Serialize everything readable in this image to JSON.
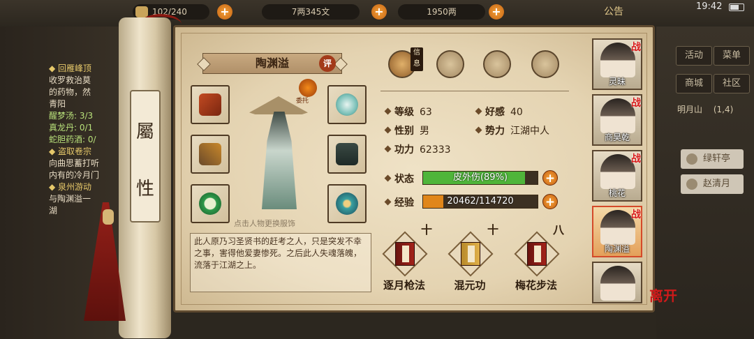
{
  "topbar": {
    "bag_label": "货物",
    "bag_count": "102/240",
    "copper": "7两345文",
    "silver": "1950两",
    "notice": "公告",
    "clock": "19:42"
  },
  "quest_log": {
    "q1_title": "◆ 回雁峰顶",
    "q1_lines": [
      "收罗救治莫",
      "的药物，然",
      "青阳"
    ],
    "q1_items": [
      "醒梦汤: 3/3",
      "真龙丹: 0/1",
      "蛇胆药酒: 0/"
    ],
    "q2_title": "◆ 盗取卷宗",
    "q2_lines": [
      "向曲思蓄打听",
      "内有的冷月门"
    ],
    "q3_title": "◆ 泉州游动",
    "q3_lines": [
      "与陶渊溢一",
      "湖"
    ]
  },
  "scroll": {
    "label_top": "屬",
    "label_bottom": "性"
  },
  "character": {
    "name": "陶渊溢",
    "rate_label": "评",
    "entrust_label": "委托",
    "hint": "点击人物更换服饰",
    "bio": "此人原乃习圣贤书的赶考之人，只是突发不幸之事，害得他爱妻惨死。之后此人失魂落魄，流落于江湖之上。"
  },
  "tabs": {
    "info_tag": "信息"
  },
  "stats": {
    "level_label": "等级",
    "level": "63",
    "favor_label": "好感",
    "favor": "40",
    "gender_label": "性别",
    "gender": "男",
    "faction_label": "势力",
    "faction": "江湖中人",
    "power_label": "功力",
    "power": "62333",
    "status_label": "状态",
    "status_value": "皮外伤(89%)",
    "status_pct": 0.89,
    "exp_label": "经验",
    "exp_value": "20462/114720",
    "exp_pct": 0.178
  },
  "skills": [
    {
      "name": "逐月枪法",
      "level": "十"
    },
    {
      "name": "混元功",
      "level": "十"
    },
    {
      "name": "梅花步法",
      "level": "八"
    }
  ],
  "roster": [
    {
      "name": "灵昧",
      "war": "战"
    },
    {
      "name": "商昊乾",
      "war": "战"
    },
    {
      "name": "桃花",
      "war": "战"
    },
    {
      "name": "陶渊溢",
      "war": "战"
    },
    {
      "name": "",
      "war": ""
    }
  ],
  "leave_label": "离开",
  "right_menu": {
    "activity": "活动",
    "menu": "菜单",
    "shop": "商城",
    "community": "社区",
    "location": "明月山",
    "coord": "(1,4)",
    "sub1": "绿轩亭",
    "sub2": "赵清月"
  },
  "colors": {
    "status_fill": "#4fb53a",
    "exp_fill": "#e0861a",
    "accent_red": "#d81a1a"
  }
}
